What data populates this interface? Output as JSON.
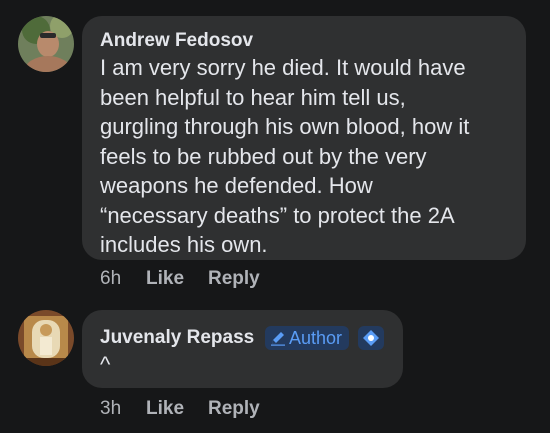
{
  "comments": [
    {
      "author": "Andrew Fedosov",
      "lines": [
        "I am very sorry he died. It would have",
        "been helpful to hear him tell us,",
        "gurgling through his own blood, how it",
        "feels to be rubbed out by the very",
        "weapons he defended. How",
        "“necessary deaths” to protect the 2A",
        "includes his own."
      ],
      "time": "6h",
      "like_label": "Like",
      "reply_label": "Reply",
      "avatar_icon": "user-photo-avatar"
    },
    {
      "author": "Juvenaly Repass",
      "badge": "Author",
      "lines": [
        "^"
      ],
      "time": "3h",
      "like_label": "Like",
      "reply_label": "Reply",
      "avatar_icon": "icon-photo-avatar"
    }
  ],
  "colors": {
    "background": "#161718",
    "bubble": "#2f3031",
    "text": "#e4e6eb",
    "secondary_text": "#b0b3b8",
    "author_badge_bg": "#233a5e",
    "author_badge_text": "#5a9cf5"
  }
}
